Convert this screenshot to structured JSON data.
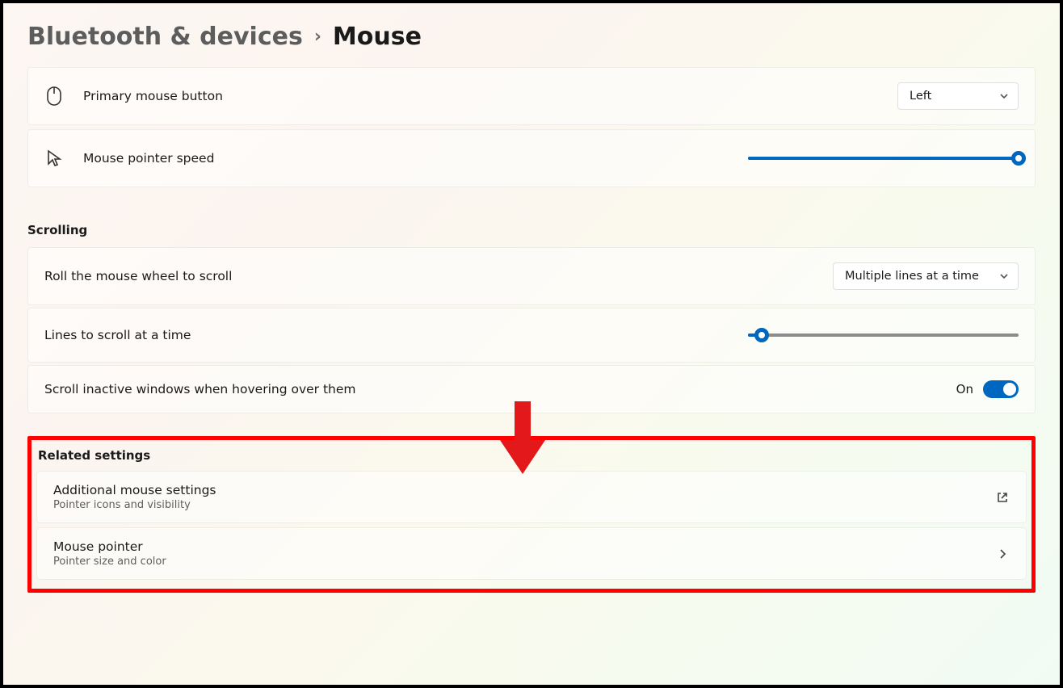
{
  "breadcrumb": {
    "parent": "Bluetooth & devices",
    "separator": "›",
    "current": "Mouse"
  },
  "primary_button": {
    "label": "Primary mouse button",
    "value": "Left"
  },
  "pointer_speed": {
    "label": "Mouse pointer speed",
    "value_pct": 100
  },
  "scrolling": {
    "heading": "Scrolling",
    "wheel": {
      "label": "Roll the mouse wheel to scroll",
      "value": "Multiple lines at a time"
    },
    "lines": {
      "label": "Lines to scroll at a time",
      "value_pct": 5
    },
    "inactive": {
      "label": "Scroll inactive windows when hovering over them",
      "state_label": "On",
      "on": true
    }
  },
  "related": {
    "heading": "Related settings",
    "items": [
      {
        "title": "Additional mouse settings",
        "sub": "Pointer icons and visibility",
        "action": "external"
      },
      {
        "title": "Mouse pointer",
        "sub": "Pointer size and color",
        "action": "chevron"
      }
    ]
  },
  "colors": {
    "accent": "#0067c0",
    "highlight_border": "#f00"
  }
}
